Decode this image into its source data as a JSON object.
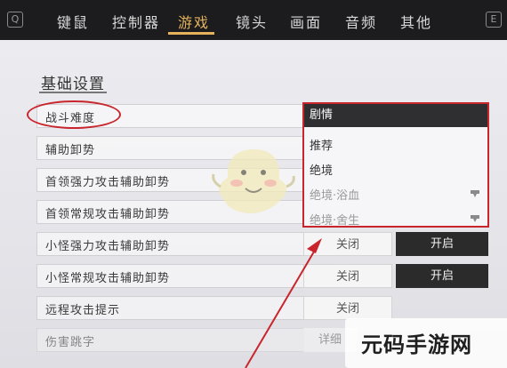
{
  "tabs": [
    {
      "label": "键鼠",
      "active": false
    },
    {
      "label": "控制器",
      "active": false
    },
    {
      "label": "游戏",
      "active": true
    },
    {
      "label": "镜头",
      "active": false
    },
    {
      "label": "画面",
      "active": false
    },
    {
      "label": "音频",
      "active": false
    },
    {
      "label": "其他",
      "active": false
    }
  ],
  "key_left": "Q",
  "key_right": "E",
  "section_title": "基础设置",
  "rows": [
    {
      "label": "战斗难度"
    },
    {
      "label": "辅助卸势"
    },
    {
      "label": "首领强力攻击辅助卸势"
    },
    {
      "label": "首领常规攻击辅助卸势"
    },
    {
      "label": "小怪强力攻击辅助卸势",
      "off": "关闭",
      "on": "开启"
    },
    {
      "label": "小怪常规攻击辅助卸势",
      "off": "关闭",
      "on": "开启"
    },
    {
      "label": "远程攻击提示",
      "off": "关闭"
    },
    {
      "label": "伤害跳字",
      "off": "详细"
    }
  ],
  "dropdown": {
    "selected": "剧情",
    "options": [
      {
        "label": "推荐",
        "locked": false
      },
      {
        "label": "绝境",
        "locked": false
      },
      {
        "label": "绝境·浴血",
        "locked": true
      },
      {
        "label": "绝境·舍生",
        "locked": true
      }
    ]
  },
  "watermark": "元码手游网",
  "colors": {
    "accent": "#e3b25b",
    "highlight": "#c8262c",
    "topbar": "#1c1c1e"
  }
}
